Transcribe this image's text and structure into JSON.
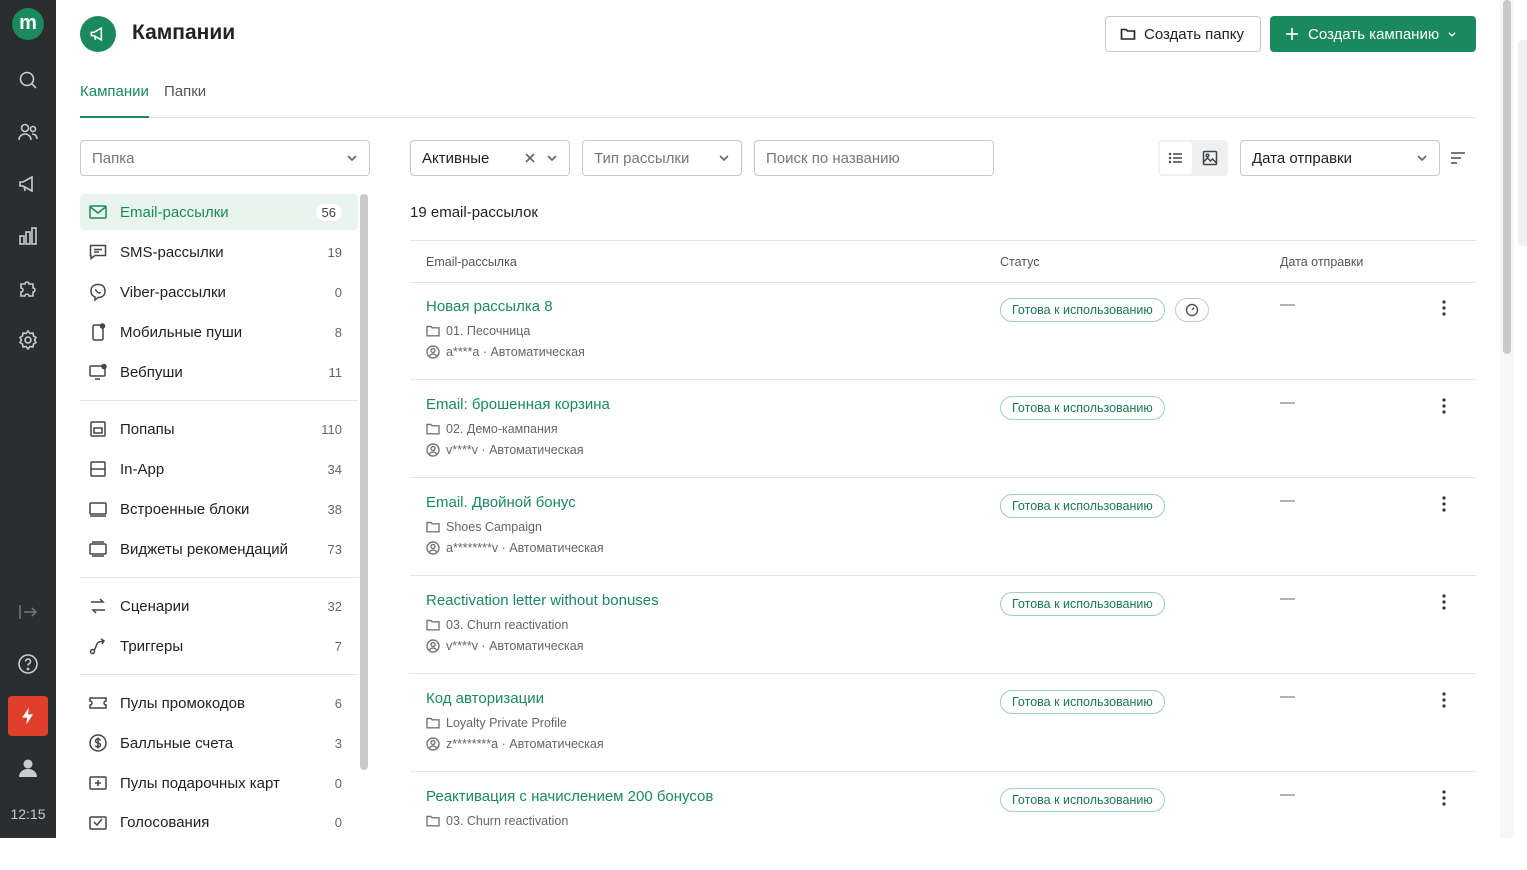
{
  "rail": {
    "logo": "m",
    "time": "12:15"
  },
  "header": {
    "title": "Кампании",
    "create_folder": "Создать папку",
    "create_campaign": "Создать кампанию"
  },
  "tabs": [
    {
      "label": "Кампании",
      "active": true
    },
    {
      "label": "Папки",
      "active": false
    }
  ],
  "filters": {
    "folder_placeholder": "Папка",
    "status_value": "Активные",
    "type_placeholder": "Тип рассылки",
    "search_placeholder": "Поиск по названию",
    "sort_value": "Дата отправки"
  },
  "nav": [
    {
      "label": "Email-рассылки",
      "count": "56",
      "icon": "mail-icon",
      "active": true
    },
    {
      "label": "SMS-рассылки",
      "count": "19",
      "icon": "chat-icon"
    },
    {
      "label": "Viber-рассылки",
      "count": "0",
      "icon": "viber-icon"
    },
    {
      "label": "Мобильные пуши",
      "count": "8",
      "icon": "mobile-push-icon"
    },
    {
      "label": "Вебпуши",
      "count": "11",
      "icon": "web-push-icon"
    },
    {
      "label": "Попапы",
      "count": "110",
      "icon": "popup-icon"
    },
    {
      "label": "In-App",
      "count": "34",
      "icon": "in-app-icon"
    },
    {
      "label": "Встроенные блоки",
      "count": "38",
      "icon": "embedded-block-icon"
    },
    {
      "label": "Виджеты рекомендаций",
      "count": "73",
      "icon": "widget-icon"
    },
    {
      "label": "Сценарии",
      "count": "32",
      "icon": "scenario-icon"
    },
    {
      "label": "Триггеры",
      "count": "7",
      "icon": "trigger-icon"
    },
    {
      "label": "Пулы промокодов",
      "count": "6",
      "icon": "ticket-icon"
    },
    {
      "label": "Балльные счета",
      "count": "3",
      "icon": "dollar-icon"
    },
    {
      "label": "Пулы подарочных карт",
      "count": "0",
      "icon": "gift-card-icon"
    },
    {
      "label": "Голосования",
      "count": "0",
      "icon": "vote-icon"
    }
  ],
  "list": {
    "count_label": "19 email-рассылок",
    "columns": [
      "Email-рассылка",
      "Статус",
      "Дата отправки"
    ],
    "rows": [
      {
        "name": "Новая рассылка 8",
        "folder": "01. Песочница",
        "author": "a****a · Автоматическая",
        "status": "Готова к использованию",
        "date": "—",
        "gauge": true
      },
      {
        "name": "Email: брошенная корзина",
        "folder": "02. Демо-кампания",
        "author": "v****v · Автоматическая",
        "status": "Готова к использованию",
        "date": "—"
      },
      {
        "name": "Email. Двойной бонус",
        "folder": "Shoes Campaign",
        "author": "a********v · Автоматическая",
        "status": "Готова к использованию",
        "date": "—"
      },
      {
        "name": "Reactivation letter without bonuses",
        "folder": "03. Churn reactivation",
        "author": "v****v · Автоматическая",
        "status": "Готова к использованию",
        "date": "—"
      },
      {
        "name": "Код авторизации",
        "folder": "Loyalty Private Profile",
        "author": "z********a · Автоматическая",
        "status": "Готова к использованию",
        "date": "—"
      },
      {
        "name": "Реактивация с начислением 200 бонусов",
        "folder": "03. Churn reactivation",
        "author": "",
        "status": "Готова к использованию",
        "date": "—"
      }
    ]
  },
  "colors": {
    "brand": "#1a8a5e",
    "rail_bg": "#2b2d2f",
    "accent_red": "#e0402b"
  }
}
